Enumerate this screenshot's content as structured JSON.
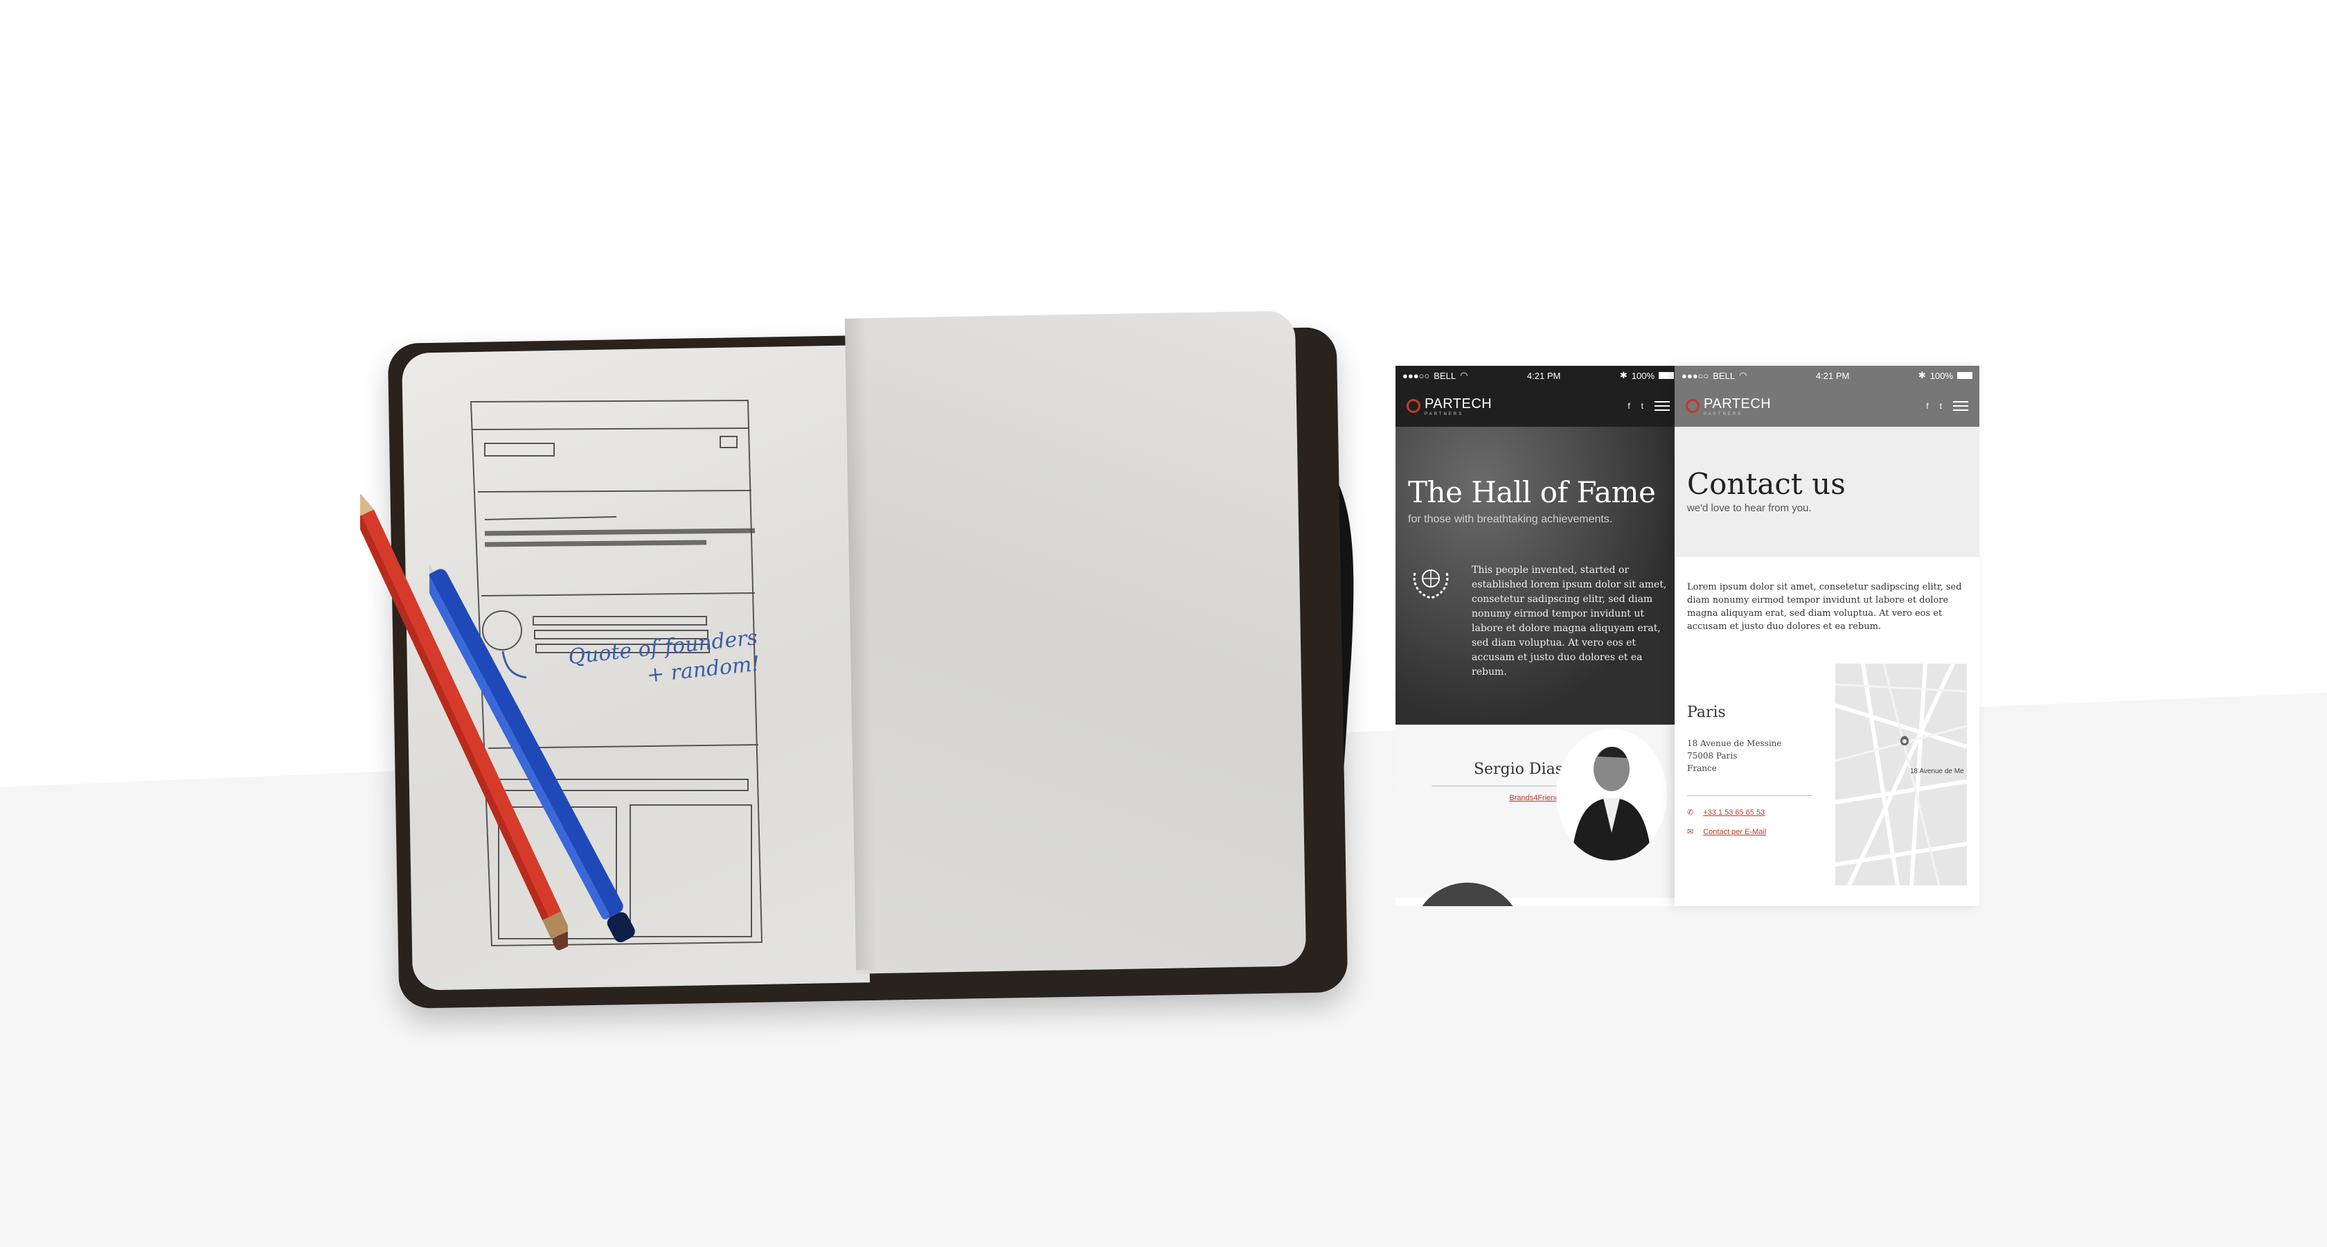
{
  "sketch": {
    "annotation_line1": "Quote of founders",
    "annotation_line2": "+ random!"
  },
  "phone_hall": {
    "status": {
      "carrier": "BELL",
      "time": "4:21 PM",
      "battery": "100%"
    },
    "nav": {
      "logo": "PARTECH",
      "logo_sub": "PARTNERS",
      "icons": [
        "facebook-icon",
        "twitter-icon",
        "menu-icon"
      ]
    },
    "hero": {
      "title": "The Hall of Fame",
      "subtitle": "for those with breathtaking achievements.",
      "body": "This people invented, started or established lorem ipsum dolor sit amet, consetetur sadipscing elitr, sed diam nonumy eirmod tempor invidunt ut labore et dolore magna aliquyam erat, sed diam voluptua. At vero eos et accusam et justo duo dolores et ea rebum."
    },
    "profile": {
      "name": "Sergio Dias",
      "company": "Brands4Friends"
    }
  },
  "phone_contact": {
    "status": {
      "carrier": "BELL",
      "time": "4:21 PM",
      "battery": "100%"
    },
    "nav": {
      "logo": "PARTECH",
      "logo_sub": "PARTNERS"
    },
    "header": {
      "title": "Contact us",
      "subtitle": "we'd love to hear from you."
    },
    "intro": "Lorem ipsum dolor sit amet, consetetur sadipscing elitr, sed diam nonumy eirmod tempor invidunt ut labore et dolore magna aliquyam erat, sed diam voluptua. At vero eos et accusam et justo duo dolores et ea rebum.",
    "office": {
      "city": "Paris",
      "address_line1": "18 Avenue de Messine",
      "address_line2": "75008 Paris",
      "address_line3": "France",
      "phone": "+33 1 53 65 65 53",
      "email_label": "Contact per E-Mail"
    },
    "map_label": "18 Avenue de Me"
  },
  "colors": {
    "accent": "#c0392b",
    "dark_nav": "#1f1f1f",
    "grey_nav": "#777777"
  }
}
